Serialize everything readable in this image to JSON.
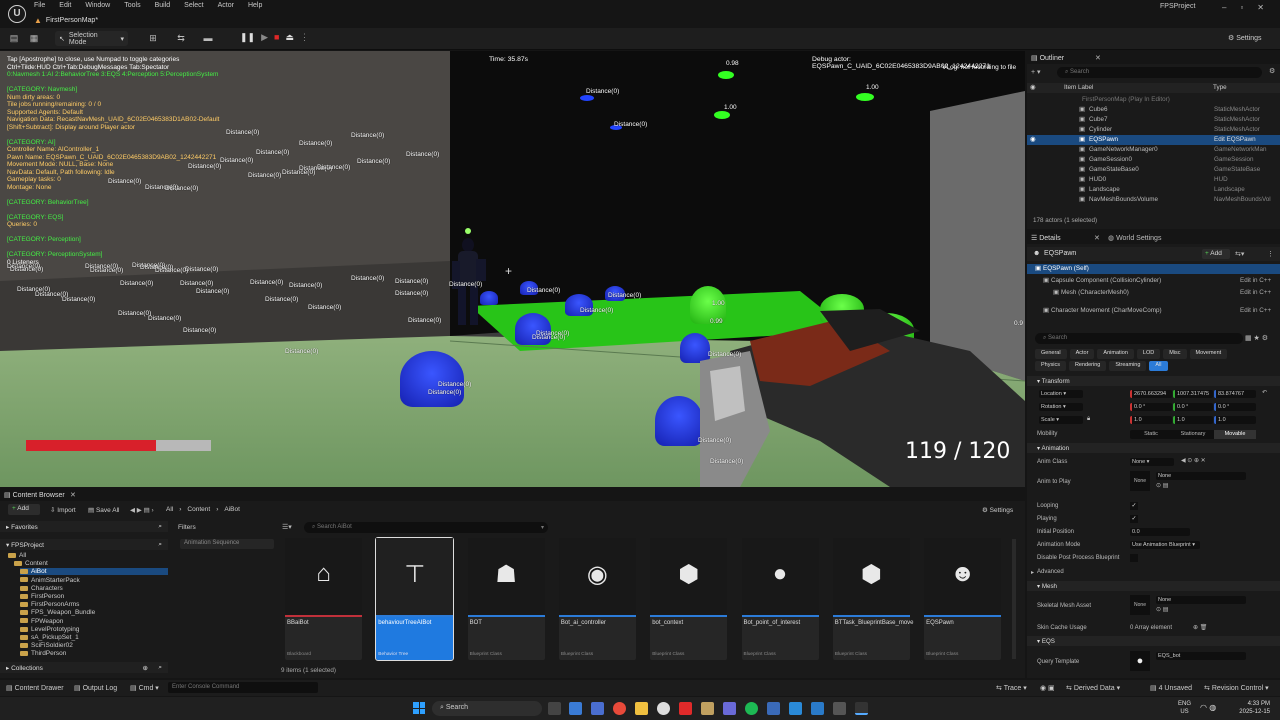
{
  "titlebar": {
    "menus": [
      "File",
      "Edit",
      "Window",
      "Tools",
      "Build",
      "Select",
      "Actor",
      "Help"
    ],
    "map_tab": "FirstPersonMap*",
    "project": "FPSProject"
  },
  "toolbar": {
    "selection_mode": "Selection Mode",
    "settings": "Settings"
  },
  "viewport": {
    "debug_lines": [
      {
        "c": "white",
        "t": "Tap [Apostrophe] to close, use Numpad to toggle categories"
      },
      {
        "c": "white",
        "t": "Ctrl+Tilde:HUD  Ctrl+Tab:DebugMessages  Tab:Spectator"
      },
      {
        "c": "green",
        "t": "0:Navmesh  1:AI  2:BehaviorTree  3:EQS  4:Perception  5:PerceptionSystem"
      },
      {
        "c": "white",
        "t": ""
      },
      {
        "c": "green",
        "t": "[CATEGORY: Navmesh]"
      },
      {
        "c": "orange",
        "t": "Num dirty areas: 0"
      },
      {
        "c": "orange",
        "t": "Tile jobs running/remaining: 0 / 0"
      },
      {
        "c": "orange",
        "t": "Supported Agents: Default"
      },
      {
        "c": "orange",
        "t": "Navigation Data: RecastNavMesh_UAID_6C02E0465383D1AB02-Default"
      },
      {
        "c": "orange",
        "t": "[Shift+Subtract]: Display around Player actor"
      },
      {
        "c": "white",
        "t": ""
      },
      {
        "c": "green",
        "t": "[CATEGORY: AI]"
      },
      {
        "c": "orange",
        "t": "Controller Name: AIController_1"
      },
      {
        "c": "orange",
        "t": "Pawn Name: EQSPawn_C_UAID_6C02E0465383D9AB02_1242442271"
      },
      {
        "c": "orange",
        "t": "Movement Mode: NULL, Base: None"
      },
      {
        "c": "orange",
        "t": "NavData: Default, Path following: Idle"
      },
      {
        "c": "orange",
        "t": "Gameplay tasks: 0"
      },
      {
        "c": "orange",
        "t": "Montage: None"
      },
      {
        "c": "white",
        "t": ""
      },
      {
        "c": "green",
        "t": "[CATEGORY: BehaviorTree]"
      },
      {
        "c": "white",
        "t": ""
      },
      {
        "c": "green",
        "t": "[CATEGORY: EQS]"
      },
      {
        "c": "orange",
        "t": "Queries: 0"
      },
      {
        "c": "white",
        "t": ""
      },
      {
        "c": "green",
        "t": "[CATEGORY: Perception]"
      },
      {
        "c": "white",
        "t": ""
      },
      {
        "c": "green",
        "t": "[CATEGORY: PerceptionSystem]"
      },
      {
        "c": "white",
        "t": "0 Listeners"
      }
    ],
    "time": "Time: 35.87s",
    "debug_actor": "Debug actor: EQSPawn_C_UAID_6C02E0465383D9AB02_1242442271",
    "vlog": "VLog: not recording to file",
    "distance_label": "Distance(0)",
    "score_labels": [
      "0.98",
      "1.00",
      "1.00",
      "0.99",
      "0.9",
      "1.00"
    ],
    "ammo": "119 / 120",
    "health_fraction": 0.7
  },
  "outliner": {
    "tab": "Outliner",
    "search_placeholder": "Search",
    "col_label": "Item Label",
    "col_type": "Type",
    "rows": [
      {
        "n": "FirstPersonMap (Play In Editor)",
        "t": "",
        "sel": false,
        "dim": true
      },
      {
        "n": "Cube6",
        "t": "StaticMeshActor",
        "sel": false
      },
      {
        "n": "Cube7",
        "t": "StaticMeshActor",
        "sel": false
      },
      {
        "n": "Cylinder",
        "t": "StaticMeshActor",
        "sel": false
      },
      {
        "n": "EQSPawn",
        "t": "Edit EQSPawn",
        "sel": true
      },
      {
        "n": "GameNetworkManager0",
        "t": "GameNetworkMan",
        "sel": false
      },
      {
        "n": "GameSession0",
        "t": "GameSession",
        "sel": false
      },
      {
        "n": "GameStateBase0",
        "t": "GameStateBase",
        "sel": false
      },
      {
        "n": "HUD0",
        "t": "HUD",
        "sel": false
      },
      {
        "n": "Landscape",
        "t": "Landscape",
        "sel": false
      },
      {
        "n": "NavMeshBoundsVolume",
        "t": "NavMeshBoundsVol",
        "sel": false
      }
    ],
    "count": "178 actors (1 selected)"
  },
  "details": {
    "tab": "Details",
    "tab2": "World Settings",
    "actor": "EQSPawn",
    "add": "Add",
    "components": [
      {
        "n": "EQSPawn (Self)",
        "edit": "",
        "sel": true
      },
      {
        "n": "Capsule Component (CollisionCylinder)",
        "edit": "Edit in C++",
        "sel": false
      },
      {
        "n": "Mesh (CharacterMesh0)",
        "edit": "Edit in C++",
        "sel": false
      },
      {
        "n": "Character Movement (CharMoveComp)",
        "edit": "Edit in C++",
        "sel": false
      }
    ],
    "search_placeholder": "Search",
    "filters1": [
      "General",
      "Actor",
      "Animation",
      "LOD",
      "Misc",
      "Movement"
    ],
    "filters2": [
      "Physics",
      "Rendering",
      "Streaming",
      "All"
    ],
    "transform": "Transform",
    "location": "Location",
    "rotation": "Rotation",
    "scale": "Scale",
    "loc_vals": [
      "2670.663294",
      "1007.317475",
      "83.874767"
    ],
    "rot_vals": [
      "0.0 °",
      "0.0 °",
      "0.0 °"
    ],
    "scale_vals": [
      "1.0",
      "1.0",
      "1.0"
    ],
    "mobility": "Mobility",
    "mob_opts": [
      "Static",
      "Stationary",
      "Movable"
    ],
    "animation": "Animation",
    "anim_class": "Anim Class",
    "anim_class_val": "None",
    "anim_to_play": "Anim to Play",
    "none": "None",
    "looping": "Looping",
    "playing": "Playing",
    "initial_position": "Initial Position",
    "initial_val": "0.0",
    "anim_mode": "Animation Mode",
    "anim_mode_val": "Use Animation Blueprint",
    "disable_pp": "Disable Post Process Blueprint",
    "advanced": "Advanced",
    "mesh": "Mesh",
    "skeletal": "Skeletal Mesh Asset",
    "skin_cache": "Skin Cache Usage",
    "skin_cache_val": "0 Array element",
    "eqs": "EQS",
    "query_template": "Query Template",
    "query_val": "EQS_bot"
  },
  "content": {
    "tab": "Content Browser",
    "add": "Add",
    "import": "Import",
    "save_all": "Save All",
    "crumbs": [
      "All",
      "Content",
      "AiBot"
    ],
    "settings": "Settings",
    "favorites": "Favorites",
    "project": "FPSProject",
    "filters": "Filters",
    "filter_chip": "Animation Sequence",
    "search_placeholder": "Search AiBot",
    "tree": [
      {
        "n": "All",
        "d": 0,
        "sel": false
      },
      {
        "n": "Content",
        "d": 1,
        "sel": false
      },
      {
        "n": "AiBot",
        "d": 2,
        "sel": true
      },
      {
        "n": "AnimStarterPack",
        "d": 2,
        "sel": false
      },
      {
        "n": "Characters",
        "d": 2,
        "sel": false
      },
      {
        "n": "FirstPerson",
        "d": 2,
        "sel": false
      },
      {
        "n": "FirstPersonArms",
        "d": 2,
        "sel": false
      },
      {
        "n": "FPS_Weapon_Bundle",
        "d": 2,
        "sel": false
      },
      {
        "n": "FPWeapon",
        "d": 2,
        "sel": false
      },
      {
        "n": "LevelPrototyping",
        "d": 2,
        "sel": false
      },
      {
        "n": "sA_PickupSet_1",
        "d": 2,
        "sel": false
      },
      {
        "n": "SciFiSoldier02",
        "d": 2,
        "sel": false
      },
      {
        "n": "ThirdPerson",
        "d": 2,
        "sel": false
      }
    ],
    "collections": "Collections",
    "items": [
      {
        "n": "BBaiBot",
        "c": "Blackboard",
        "bar": "#c0303a",
        "sel": false,
        "ic": "⌂"
      },
      {
        "n": "behaviourTreeAIBot",
        "c": "Behavior Tree",
        "bar": "#2b7bd8",
        "sel": true,
        "ic": "⊤"
      },
      {
        "n": "BOT",
        "c": "Blueprint Class",
        "bar": "#2b7bd8",
        "sel": false,
        "ic": "☗"
      },
      {
        "n": "Bot_ai_controller",
        "c": "Blueprint Class",
        "bar": "#2b7bd8",
        "sel": false,
        "ic": "◉"
      },
      {
        "n": "bot_context",
        "c": "Blueprint Class",
        "bar": "#2b7bd8",
        "sel": false,
        "ic": "⬢"
      },
      {
        "n": "Bot_point_of_interest",
        "c": "Blueprint Class",
        "bar": "#2b7bd8",
        "sel": false,
        "ic": "●"
      },
      {
        "n": "BTTask_BlueprintBase_move",
        "c": "Blueprint Class",
        "bar": "#2b7bd8",
        "sel": false,
        "ic": "⬢"
      },
      {
        "n": "EQSPawn",
        "c": "Blueprint Class",
        "bar": "#2b7bd8",
        "sel": false,
        "ic": "☻"
      }
    ],
    "count": "9 items (1 selected)"
  },
  "status": {
    "drawer": "Content Drawer",
    "output": "Output Log",
    "cmd": "Cmd",
    "console_placeholder": "Enter Console Command",
    "trace": "Trace",
    "derived": "Derived Data",
    "unsaved": "4 Unsaved",
    "revision": "Revision Control"
  },
  "taskbar": {
    "search": "Search",
    "lang": "ENG",
    "region": "US",
    "time": "4:33 PM",
    "date": "2025-12-15"
  }
}
